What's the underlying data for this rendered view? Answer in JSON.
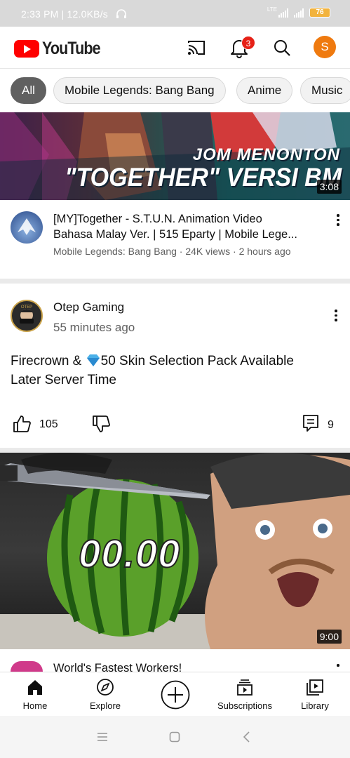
{
  "status_bar": {
    "time_speed": "2:33 PM | 12.0KB/s",
    "network": "LTE",
    "battery": "76"
  },
  "header": {
    "logo_text": "YouTube",
    "notification_count": "3",
    "avatar_letter": "S"
  },
  "chips": [
    {
      "label": "All",
      "active": true
    },
    {
      "label": "Mobile Legends: Bang Bang",
      "active": false
    },
    {
      "label": "Anime",
      "active": false
    },
    {
      "label": "Music",
      "active": false
    }
  ],
  "video1": {
    "thumb_line1": "JOM MENONTON",
    "thumb_line2": "\"TOGETHER\" VERSI BM",
    "duration": "3:08",
    "title_line1": "[MY]Together - S.T.U.N. Animation Video",
    "title_line2": "Bahasa Malay Ver. | 515 Eparty | Mobile Lege...",
    "meta": "Mobile Legends: Bang Bang · 24K views · 2 hours ago"
  },
  "post": {
    "channel": "Otep Gaming",
    "time": "55 minutes ago",
    "text_part1": "Firecrown & ",
    "text_part2": "50 Skin Selection Pack Available",
    "text_line2": "Later Server Time",
    "likes": "105",
    "comments": "9",
    "avatar_text": "OTEP"
  },
  "video2": {
    "thumb_timer": "00.00",
    "duration": "9:00",
    "title": "World's Fastest Workers!"
  },
  "bottom_nav": [
    {
      "label": "Home",
      "icon": "home-icon"
    },
    {
      "label": "Explore",
      "icon": "compass-icon"
    },
    {
      "label": "",
      "icon": "create-icon"
    },
    {
      "label": "Subscriptions",
      "icon": "subscriptions-icon"
    },
    {
      "label": "Library",
      "icon": "library-icon"
    }
  ],
  "colors": {
    "brand_red": "#ff0000",
    "avatar_orange": "#ef7a0f",
    "chip_active": "#606060"
  }
}
